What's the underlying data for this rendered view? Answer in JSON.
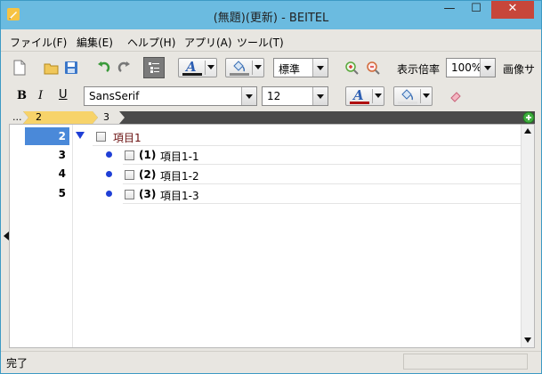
{
  "window": {
    "title": "(無題)(更新) - BEITEL",
    "minimize_glyph": "—",
    "maximize_glyph": "☐",
    "close_glyph": "✕"
  },
  "menu": [
    {
      "label": "ファイル(F)"
    },
    {
      "label": "編集(E)"
    },
    {
      "label": "ヘルプ(H)"
    },
    {
      "label": "アプリ(A)"
    },
    {
      "label": "ツール(T)"
    }
  ],
  "toolbar1": {
    "style_value": "標準",
    "zoom_label": "表示倍率",
    "zoom_value": "100%",
    "image_label": "画像サ",
    "colors": {
      "font_color": "#1a1a1a",
      "fill_color": "#8a8a8a"
    }
  },
  "toolbar2": {
    "bold": "B",
    "italic": "I",
    "underline": "U",
    "font_family": "SansSerif",
    "font_size": "12",
    "font_color_glyph": "A",
    "colors": {
      "font_color": "#b01010",
      "fill_color": "#e0e0e0"
    }
  },
  "breadcrumb": {
    "items": [
      "...",
      "2",
      "3"
    ]
  },
  "outline": {
    "rows": [
      {
        "num": "2",
        "marker": "▼",
        "number_label": "",
        "text": "項目1",
        "selected": true
      },
      {
        "num": "3",
        "marker": "●",
        "number_label": "(1)",
        "text": "項目1-1",
        "selected": false
      },
      {
        "num": "4",
        "marker": "●",
        "number_label": "(2)",
        "text": "項目1-2",
        "selected": false
      },
      {
        "num": "5",
        "marker": "●",
        "number_label": "(3)",
        "text": "項目1-3",
        "selected": false
      }
    ]
  },
  "statusbar": {
    "text": "完了"
  },
  "accent_color": "#4a89d9",
  "title_bar_color": "#6bbbe0",
  "close_color": "#c7463a"
}
